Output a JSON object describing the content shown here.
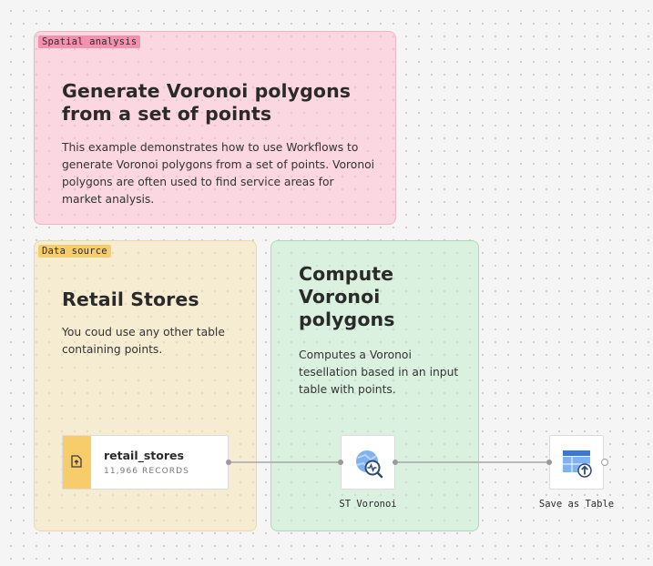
{
  "groups": {
    "spatial": {
      "tag": "Spatial analysis",
      "title": "Generate Voronoi polygons from a set of points",
      "description": "This example demonstrates how to use Workflows to generate Voronoi polygons from a set of points. Voronoi polygons are often used to find service areas for market analysis.",
      "color": "#f491ae"
    },
    "data_source": {
      "tag": "Data source",
      "title": "Retail Stores",
      "description": "You coud use any other table containing points.",
      "color": "#f6cd6a"
    },
    "compute": {
      "title": "Compute Voronoi polygons",
      "description": "Computes a Voronoi tesellation based in an input table with points.",
      "color": "#c6ecce"
    }
  },
  "nodes": {
    "source": {
      "name": "retail_stores",
      "meta": "11,966 RECORDS",
      "icon": "table-upload-icon"
    },
    "voronoi": {
      "label": "ST Voronoi",
      "icon": "voronoi-analysis-icon"
    },
    "save": {
      "label": "Save as Table",
      "icon": "save-table-icon"
    }
  }
}
